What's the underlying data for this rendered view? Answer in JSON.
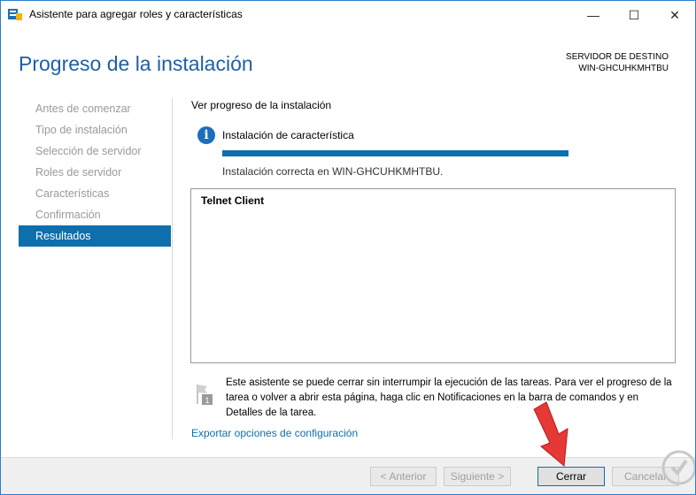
{
  "window": {
    "title": "Asistente para agregar roles y características",
    "minimize": "—",
    "maximize": "☐",
    "close": "✕"
  },
  "header": {
    "title": "Progreso de la instalación",
    "server_label": "SERVIDOR DE DESTINO",
    "server_name": "WIN-GHCUHKMHTBU"
  },
  "nav": {
    "items": [
      {
        "label": "Antes de comenzar"
      },
      {
        "label": "Tipo de instalación"
      },
      {
        "label": "Selección de servidor"
      },
      {
        "label": "Roles de servidor"
      },
      {
        "label": "Características"
      },
      {
        "label": "Confirmación"
      },
      {
        "label": "Resultados"
      }
    ],
    "active_index": 6
  },
  "main": {
    "section_title": "Ver progreso de la instalación",
    "install_label": "Instalación de característica",
    "progress_percent": 100,
    "success_text": "Instalación correcta en WIN-GHCUHKMHTBU.",
    "results": [
      "Telnet Client"
    ],
    "note": "Este asistente se puede cerrar sin interrumpir la ejecución de las tareas. Para ver el progreso de la tarea o volver a abrir esta página, haga clic en Notificaciones en la barra de comandos y en Detalles de la tarea.",
    "export_link": "Exportar opciones de configuración",
    "flag_badge": "1"
  },
  "footer": {
    "prev": "< Anterior",
    "next": "Siguiente >",
    "close": "Cerrar",
    "cancel": "Cancelar"
  },
  "colors": {
    "accent": "#0e6fad",
    "title": "#1f5fa6",
    "arrow": "#e53935"
  }
}
